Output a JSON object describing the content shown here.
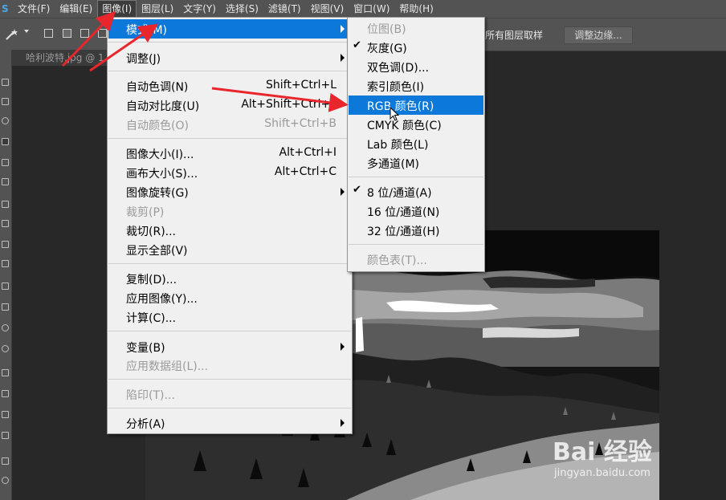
{
  "menubar": {
    "items": [
      {
        "label": "文件(F)"
      },
      {
        "label": "编辑(E)"
      },
      {
        "label": "图像(I)"
      },
      {
        "label": "图层(L)"
      },
      {
        "label": "文字(Y)"
      },
      {
        "label": "选择(S)"
      },
      {
        "label": "滤镜(T)"
      },
      {
        "label": "视图(V)"
      },
      {
        "label": "窗口(W)"
      },
      {
        "label": "帮助(H)"
      }
    ]
  },
  "options_bar": {
    "sample_all_layers": "所有图层取样",
    "refine_edge": "调整边缘..."
  },
  "document_tab": {
    "title": "哈利波特.jpg @ 1"
  },
  "image_menu": {
    "items": [
      {
        "label": "模式(M)",
        "shortcut": "",
        "submenu": true,
        "highlighted": true
      },
      {
        "label": "调整(J)",
        "shortcut": "",
        "submenu": true
      },
      {
        "label": "自动色调(N)",
        "shortcut": "Shift+Ctrl+L"
      },
      {
        "label": "自动对比度(U)",
        "shortcut": "Alt+Shift+Ctrl+L"
      },
      {
        "label": "自动颜色(O)",
        "shortcut": "Shift+Ctrl+B",
        "disabled": true
      },
      {
        "label": "图像大小(I)...",
        "shortcut": "Alt+Ctrl+I"
      },
      {
        "label": "画布大小(S)...",
        "shortcut": "Alt+Ctrl+C"
      },
      {
        "label": "图像旋转(G)",
        "shortcut": "",
        "submenu": true
      },
      {
        "label": "裁剪(P)",
        "shortcut": "",
        "disabled": true
      },
      {
        "label": "裁切(R)...",
        "shortcut": ""
      },
      {
        "label": "显示全部(V)",
        "shortcut": ""
      },
      {
        "label": "复制(D)...",
        "shortcut": ""
      },
      {
        "label": "应用图像(Y)...",
        "shortcut": ""
      },
      {
        "label": "计算(C)...",
        "shortcut": ""
      },
      {
        "label": "变量(B)",
        "shortcut": "",
        "submenu": true
      },
      {
        "label": "应用数据组(L)...",
        "shortcut": "",
        "disabled": true
      },
      {
        "label": "陷印(T)...",
        "shortcut": "",
        "disabled": true
      },
      {
        "label": "分析(A)",
        "shortcut": "",
        "submenu": true
      }
    ]
  },
  "mode_menu": {
    "items": [
      {
        "label": "位图(B)",
        "disabled": true
      },
      {
        "label": "灰度(G)",
        "checked": true
      },
      {
        "label": "双色调(D)..."
      },
      {
        "label": "索引颜色(I)"
      },
      {
        "label": "RGB 颜色(R)",
        "highlighted": true
      },
      {
        "label": "CMYK 颜色(C)"
      },
      {
        "label": "Lab 颜色(L)"
      },
      {
        "label": "多通道(M)"
      },
      {
        "label": "8 位/通道(A)",
        "checked": true
      },
      {
        "label": "16 位/通道(N)"
      },
      {
        "label": "32 位/通道(H)"
      },
      {
        "label": "颜色表(T)...",
        "disabled": true
      }
    ]
  },
  "watermark": {
    "brand": "Bai 经验",
    "url": "jingyan.baidu.com"
  },
  "colors": {
    "highlight": "#0c78d9",
    "annotation_arrow": "#e8262b",
    "menu_bg": "#f0f0f0",
    "ui_gray": "#535353"
  }
}
